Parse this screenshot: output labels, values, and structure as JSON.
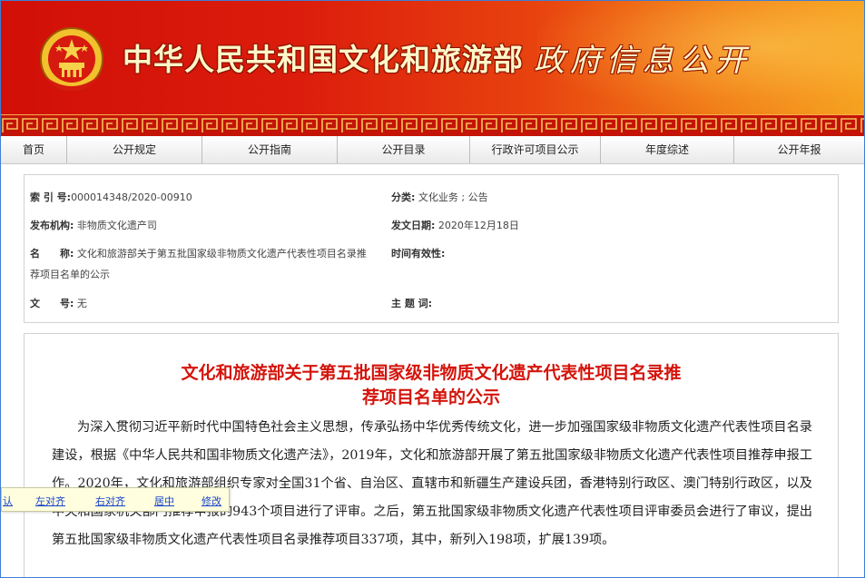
{
  "header": {
    "site_title": "中华人民共和国文化和旅游部",
    "site_subtitle": "政府信息公开",
    "colors": {
      "banner_red": "#d10f08",
      "banner_orange": "#f5a21f",
      "title_text": "#fff6c8"
    },
    "emblem_icon": "national-emblem-icon"
  },
  "nav": {
    "items": [
      "首页",
      "公开规定",
      "公开指南",
      "公开目录",
      "行政许可项目公示",
      "年度综述",
      "公开年报"
    ]
  },
  "meta": {
    "index_label": "索 引 号:",
    "index_value": "000014348/2020-00910",
    "category_label": "分类:",
    "category_value": "文化业务 ; 公告",
    "publisher_label": "发布机构:",
    "publisher_value": "非物质文化遗产司",
    "date_label": "发文日期:",
    "date_value": "2020年12月18日",
    "name_label": "名　　称:",
    "name_value_line1": "文化和旅游部关于第五批国家级非物质文化遗产代表性项目名录推",
    "name_value_line2": "荐项目名单的公示",
    "validity_label": "时间有效性:",
    "doc_no_label": "文　　号:",
    "doc_no_value": "无",
    "keywords_label": "主 题 词:"
  },
  "article": {
    "title_line1": "文化和旅游部关于第五批国家级非物质文化遗产代表性项目名录推",
    "title_line2": "荐项目名单的公示",
    "title_color": "#d4140b",
    "body": "为深入贯彻习近平新时代中国特色社会主义思想，传承弘扬中华优秀传统文化，进一步加强国家级非物质文化遗产代表性项目名录建设，根据《中华人民共和国非物质文化遗产法》，2019年，文化和旅游部开展了第五批国家级非物质文化遗产代表性项目推荐申报工作。2020年，文化和旅游部组织专家对全国31个省、自治区、直辖市和新疆生产建设兵团，香港特别行政区、澳门特别行政区，以及中央和国家机关部门推荐申报的943个项目进行了评审。之后，第五批国家级非物质文化遗产代表性项目评审委员会进行了审议，提出第五批国家级非物质文化遗产代表性项目名录推荐项目337项，其中，新列入198项，扩展139项。"
  },
  "float_toolbar": {
    "items": [
      "认",
      "左对齐",
      "右对齐",
      "居中",
      "修改"
    ]
  }
}
